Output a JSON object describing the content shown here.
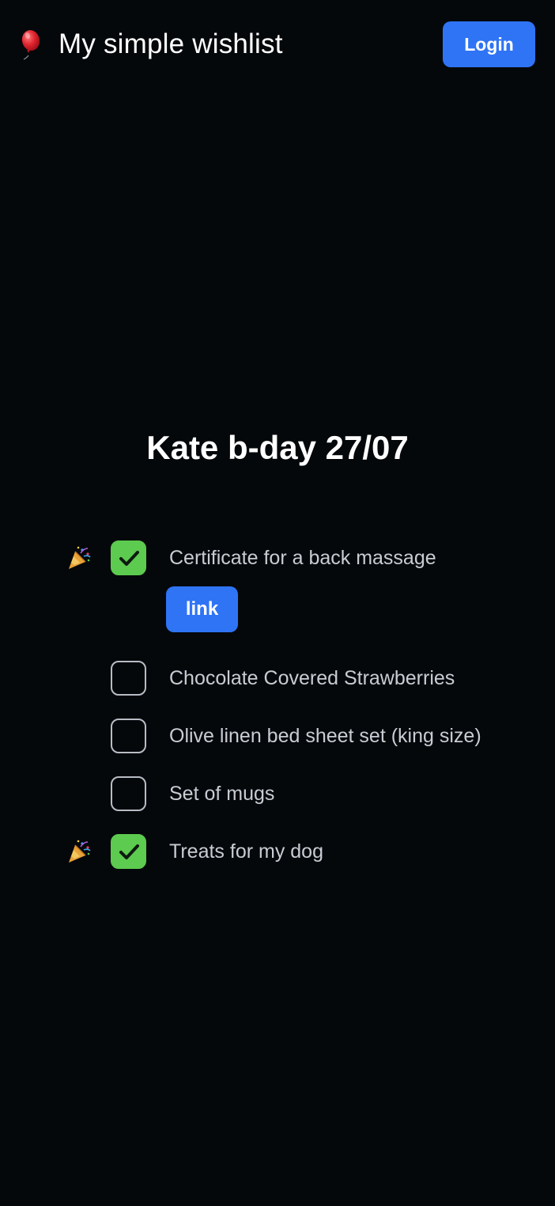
{
  "header": {
    "brand_icon": "balloon-icon",
    "title": "My simple wishlist",
    "login_label": "Login",
    "login_color": "#2f74f5"
  },
  "wishlist": {
    "title": "Kate b-day 27/07",
    "items": [
      {
        "label": "Certificate for a back massage",
        "checked": true,
        "celebrated_icon": "party-popper-icon",
        "link_label": "link"
      },
      {
        "label": "Chocolate Covered Strawberries",
        "checked": false
      },
      {
        "label": "Olive linen bed sheet set (king size)",
        "checked": false
      },
      {
        "label": "Set of mugs",
        "checked": false
      },
      {
        "label": "Treats for my dog",
        "checked": true,
        "celebrated_icon": "party-popper-icon"
      }
    ]
  },
  "colors": {
    "background": "#05080b",
    "checked": "#5ccb4f",
    "accent": "#2f74f5"
  }
}
